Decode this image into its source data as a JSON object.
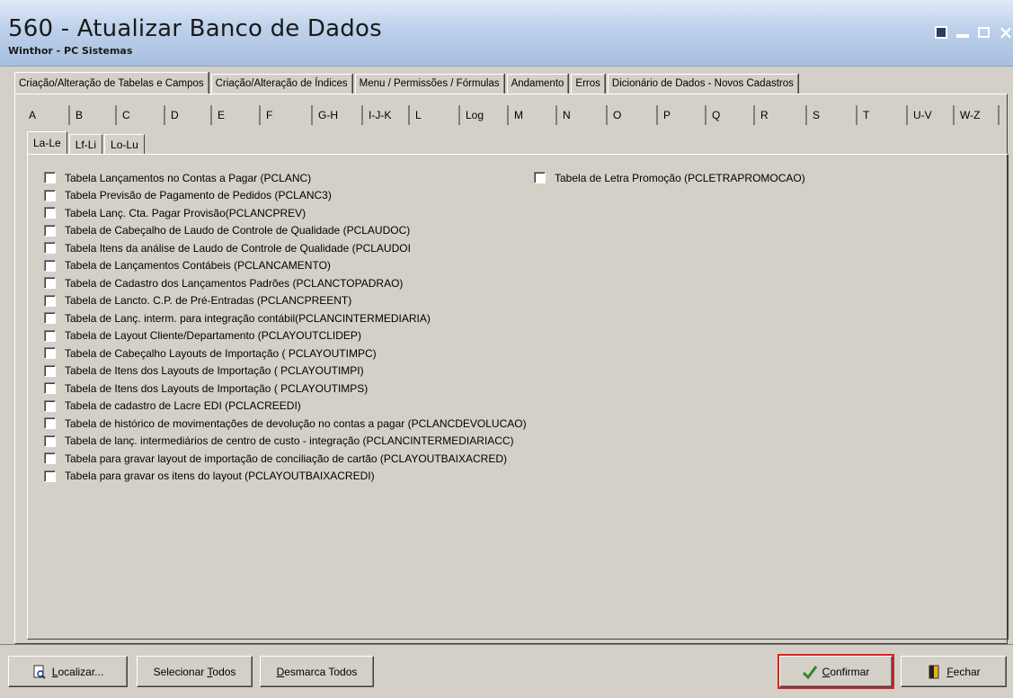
{
  "window": {
    "title": "560 - Atualizar Banco de Dados",
    "subtitle": "Winthor - PC Sistemas",
    "controls": {
      "restore": "restore-icon",
      "minimize": "minimize-icon",
      "maximize": "maximize-icon",
      "close": "×"
    }
  },
  "main_tabs": [
    "Criação/Alteração de Tabelas e Campos",
    "Criação/Alteração de Índices",
    "Menu / Permissões / Fórmulas",
    "Andamento",
    "Erros",
    "Dicionário de Dados - Novos Cadastros"
  ],
  "letter_tabs": [
    "A",
    "B",
    "C",
    "D",
    "E",
    "F",
    "G-H",
    "I-J-K",
    "L",
    "Log",
    "M",
    "N",
    "O",
    "P",
    "Q",
    "R",
    "S",
    "T",
    "U-V",
    "W-Z"
  ],
  "sub_tabs": [
    "La-Le",
    "Lf-Li",
    "Lo-Lu"
  ],
  "tables_left": [
    "Tabela Lançamentos no Contas a Pagar (PCLANC)",
    "Tabela Previsão de Pagamento de Pedidos (PCLANC3)",
    "Tabela Lanç. Cta. Pagar Provisão(PCLANCPREV)",
    "Tabela de Cabeçalho de Laudo de Controle de Qualidade (PCLAUDOC)",
    "Tabela Itens da análise de Laudo de Controle de Qualidade (PCLAUDOI",
    "Tabela de Lançamentos Contábeis (PCLANCAMENTO)",
    "Tabela de Cadastro dos Lançamentos Padrões (PCLANCTOPADRAO)",
    "Tabela de Lancto. C.P. de Pré-Entradas (PCLANCPREENT)",
    "Tabela de Lanç. interm. para integração contábil(PCLANCINTERMEDIARIA)",
    "Tabela de Layout Cliente/Departamento (PCLAYOUTCLIDEP)",
    "Tabela de Cabeçalho Layouts de Importação ( PCLAYOUTIMPC)",
    "Tabela de Itens dos Layouts de Importação ( PCLAYOUTIMPI)",
    "Tabela de Itens dos Layouts de Importação ( PCLAYOUTIMPS)",
    "Tabela de cadastro de Lacre EDI (PCLACREEDI)",
    "Tabela de histórico de movimentações de devolução no contas a pagar (PCLANCDEVOLUCAO)",
    "Tabela de lanç.  intermediários de centro de custo - integração (PCLANCINTERMEDIARIACC)",
    "Tabela para gravar layout de importação de conciliação de cartão (PCLAYOUTBAIXACRED)",
    "Tabela para gravar os itens do layout (PCLAYOUTBAIXACREDI)"
  ],
  "tables_right": [
    "Tabela de Letra Promoção (PCLETRAPROMOCAO)"
  ],
  "buttons": {
    "localizar": {
      "before": "",
      "u": "L",
      "after": "ocalizar..."
    },
    "selecionar": {
      "before": "Selecionar ",
      "u": "T",
      "after": "odos"
    },
    "desmarca": {
      "before": "",
      "u": "D",
      "after": "esmarca Todos"
    },
    "confirmar": {
      "before": "",
      "u": "C",
      "after": "onfirmar"
    },
    "fechar": {
      "before": "",
      "u": "F",
      "after": "echar"
    }
  },
  "colors": {
    "highlight": "#e02020",
    "face": "#d4d0c8"
  }
}
